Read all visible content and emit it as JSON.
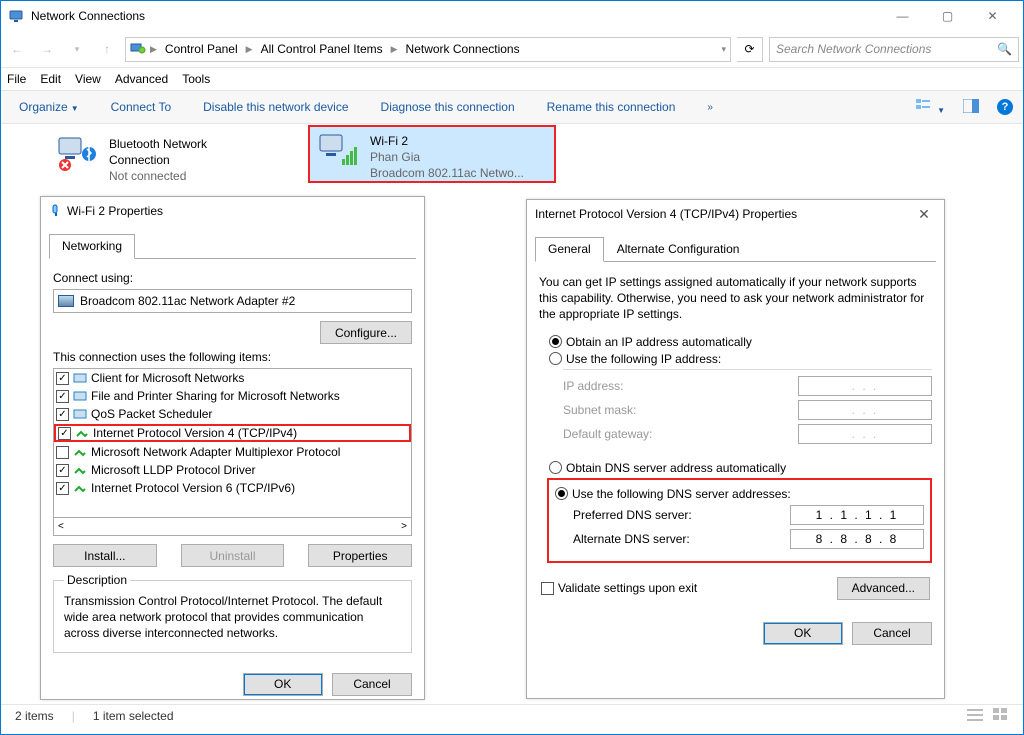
{
  "window": {
    "title": "Network Connections",
    "breadcrumb": [
      "Control Panel",
      "All Control Panel Items",
      "Network Connections"
    ],
    "search_placeholder": "Search Network Connections",
    "menubar": [
      "File",
      "Edit",
      "View",
      "Advanced",
      "Tools"
    ],
    "cmdbar": {
      "organize": "Organize",
      "connect_to": "Connect To",
      "disable": "Disable this network device",
      "diagnose": "Diagnose this connection",
      "rename": "Rename this connection"
    },
    "btn_min": "—",
    "btn_max": "▢",
    "btn_close": "✕"
  },
  "connections": {
    "bt": {
      "name": "Bluetooth Network Connection",
      "line1": "Bluetooth Network",
      "line2": "Connection",
      "status": "Not connected"
    },
    "wifi": {
      "name": "Wi-Fi 2",
      "status": "Phan Gia",
      "device": "Broadcom 802.11ac Netwo..."
    }
  },
  "wifi_props": {
    "title": "Wi-Fi 2 Properties",
    "tab_networking": "Networking",
    "connect_using": "Connect using:",
    "adapter": "Broadcom 802.11ac Network Adapter #2",
    "btn_configure": "Configure...",
    "uses_following": "This connection uses the following items:",
    "items": [
      {
        "checked": true,
        "label": "Client for Microsoft Networks"
      },
      {
        "checked": true,
        "label": "File and Printer Sharing for Microsoft Networks"
      },
      {
        "checked": true,
        "label": "QoS Packet Scheduler"
      },
      {
        "checked": true,
        "label": "Internet Protocol Version 4 (TCP/IPv4)",
        "hl": true
      },
      {
        "checked": false,
        "label": "Microsoft Network Adapter Multiplexor Protocol"
      },
      {
        "checked": true,
        "label": "Microsoft LLDP Protocol Driver"
      },
      {
        "checked": true,
        "label": "Internet Protocol Version 6 (TCP/IPv6)"
      }
    ],
    "btn_install": "Install...",
    "btn_uninstall": "Uninstall",
    "btn_properties": "Properties",
    "desc_label": "Description",
    "desc_text": "Transmission Control Protocol/Internet Protocol. The default wide area network protocol that provides communication across diverse interconnected networks.",
    "btn_ok": "OK",
    "btn_cancel": "Cancel"
  },
  "ipv4_props": {
    "title": "Internet Protocol Version 4 (TCP/IPv4) Properties",
    "tab_general": "General",
    "tab_alt": "Alternate Configuration",
    "help_text": "You can get IP settings assigned automatically if your network supports this capability. Otherwise, you need to ask your network administrator for the appropriate IP settings.",
    "opt_ip_auto": "Obtain an IP address automatically",
    "opt_ip_manual": "Use the following IP address:",
    "ip_address": "IP address:",
    "subnet": "Subnet mask:",
    "gateway": "Default gateway:",
    "opt_dns_auto": "Obtain DNS server address automatically",
    "opt_dns_manual": "Use the following DNS server addresses:",
    "pref_dns": "Preferred DNS server:",
    "alt_dns": "Alternate DNS server:",
    "pref_dns_val": "1 . 1 . 1 . 1",
    "alt_dns_val": "8 . 8 . 8 . 8",
    "validate": "Validate settings upon exit",
    "btn_advanced": "Advanced...",
    "btn_ok": "OK",
    "btn_cancel": "Cancel",
    "blank_ip": ".       .       ."
  },
  "statusbar": {
    "items": "2 items",
    "selected": "1 item selected"
  }
}
